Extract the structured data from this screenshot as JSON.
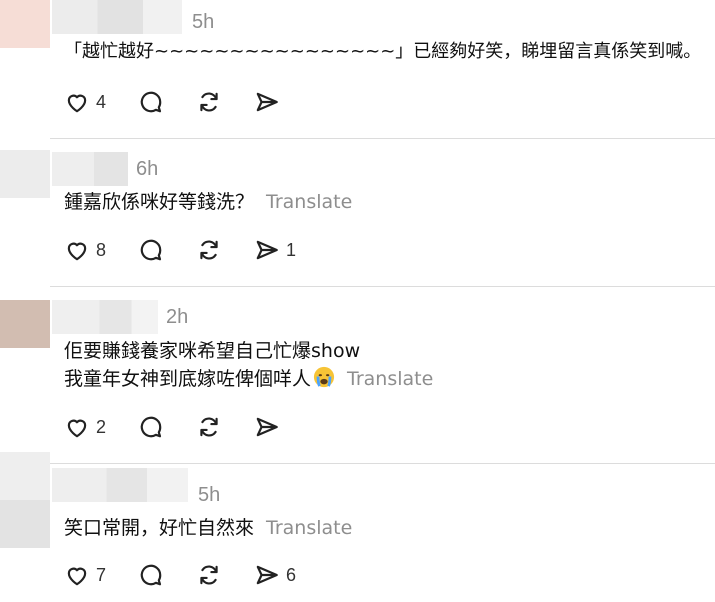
{
  "comments": [
    {
      "time": "5h",
      "lines": [
        "「越忙越好~~~~~~~~~~~~~~~~」已經夠好笑，睇埋留言真係笑到喊。"
      ],
      "translate": "",
      "likes": "4",
      "shares": ""
    },
    {
      "time": "6h",
      "lines": [
        "鍾嘉欣係咪好等錢洗？"
      ],
      "translate": "Translate",
      "likes": "8",
      "shares": "1"
    },
    {
      "time": "2h",
      "lines": [
        "佢要賺錢養家咪希望自己忙爆show",
        "我童年女神到底嫁咗俾個咩人"
      ],
      "translate": "Translate",
      "likes": "2",
      "shares": ""
    },
    {
      "time": "5h",
      "lines": [
        "笑口常開，好忙￼自然來"
      ],
      "translate": "Translate",
      "likes": "7",
      "shares": "6"
    }
  ],
  "icons": {
    "like": "heart-icon",
    "reply": "reply-bubble-icon",
    "repost": "repost-icon",
    "share": "send-icon",
    "emoji": "crying-face-emoji"
  },
  "colors": {
    "muted_text": "#8e8e8e",
    "divider": "#dcdcdc"
  }
}
